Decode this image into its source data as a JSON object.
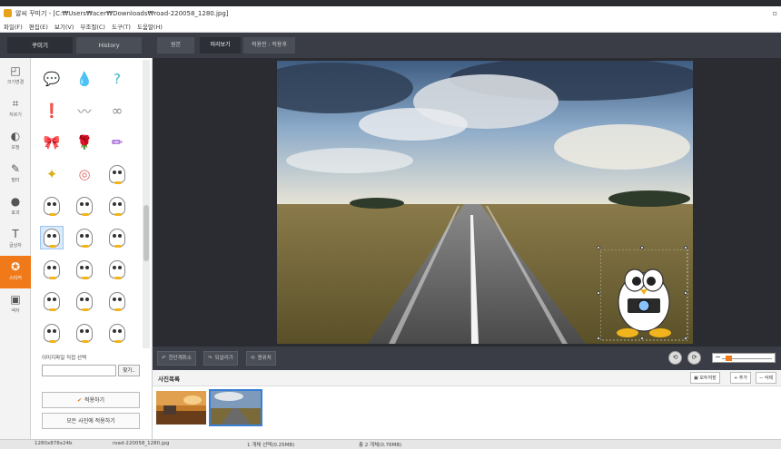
{
  "window": {
    "title": "알씨 꾸미기 - [C:₩Users₩acer₩Downloads₩road-220058_1280.jpg]",
    "control_label": "▫"
  },
  "menu": [
    "파일(F)",
    "편집(E)",
    "보기(V)",
    "부조절(C)",
    "도구(T)",
    "도움말(H)"
  ],
  "left_tabs": [
    {
      "label": "꾸미기",
      "active": true
    },
    {
      "label": "History",
      "active": false
    }
  ],
  "view_tabs": [
    {
      "label": "원본",
      "active": false
    },
    {
      "label": "미리보기",
      "active": true
    },
    {
      "label": "적용전 : 적용후",
      "active": false
    }
  ],
  "tools": [
    {
      "icon": "resize-icon",
      "glyph": "◰",
      "label": "크기변경"
    },
    {
      "icon": "crop-icon",
      "glyph": "⌗",
      "label": "자르기"
    },
    {
      "icon": "correction-icon",
      "glyph": "◐",
      "label": "보정"
    },
    {
      "icon": "brush-icon",
      "glyph": "✎",
      "label": "필터"
    },
    {
      "icon": "effect-icon",
      "glyph": "●",
      "label": "효과"
    },
    {
      "icon": "text-icon",
      "glyph": "T",
      "label": "글상자"
    },
    {
      "icon": "sticker-icon",
      "glyph": "✪",
      "label": "스티커",
      "active": true
    },
    {
      "icon": "frame-icon",
      "glyph": "▣",
      "label": "액자"
    }
  ],
  "stickers": [
    {
      "glyph": "💬",
      "color": "#f2c21a"
    },
    {
      "glyph": "💧",
      "color": "#3aa3e0"
    },
    {
      "glyph": "?",
      "color": "#38b5c8"
    },
    {
      "glyph": "❗",
      "color": "#3fb53a"
    },
    {
      "glyph": "〰",
      "color": "#888888"
    },
    {
      "glyph": "∞",
      "color": "#888888"
    },
    {
      "glyph": "🎀",
      "color": "#3a8fd0"
    },
    {
      "glyph": "🌹",
      "color": "#d03a3a"
    },
    {
      "glyph": "✏",
      "color": "#8a3ad0"
    },
    {
      "glyph": "✦",
      "color": "#d6b21a"
    },
    {
      "glyph": "◎",
      "color": "#e06a6a"
    },
    {
      "glyph": "penguin"
    },
    {
      "glyph": "penguin"
    },
    {
      "glyph": "penguin"
    },
    {
      "glyph": "penguin"
    },
    {
      "glyph": "penguin",
      "selected": true
    },
    {
      "glyph": "penguin"
    },
    {
      "glyph": "penguin"
    },
    {
      "glyph": "penguin"
    },
    {
      "glyph": "penguin"
    },
    {
      "glyph": "penguin"
    },
    {
      "glyph": "penguin"
    },
    {
      "glyph": "penguin"
    },
    {
      "glyph": "penguin"
    },
    {
      "glyph": "penguin"
    },
    {
      "glyph": "penguin"
    },
    {
      "glyph": "penguin"
    }
  ],
  "file_select": {
    "label": "이미지파일 직접 선택",
    "value": "",
    "button": "찾기.."
  },
  "apply": {
    "apply_label": "적용하기",
    "apply_all_label": "모든 사진에 적용하기"
  },
  "edit_bar": {
    "undo_label": "한단계취소",
    "redo_label": "되살리기",
    "reset_label": "원위치",
    "rotate_left_label": "⟲",
    "rotate_right_label": "⟳",
    "zoom_minus_label": "−"
  },
  "photo_list": {
    "label": "사진목록",
    "save_all": "모두저장",
    "add": "+ 추가",
    "delete": "− 삭제"
  },
  "status": {
    "dimensions": "1280x878x24b",
    "filename": "road-220058_1280.jpg",
    "selection": "1 개체 선택(0.25MB)",
    "total": "총 2 개체(0.76MB)"
  },
  "colors": {
    "accent": "#f07a1a",
    "dark": "#3a3d45",
    "selection": "#3b7fd4"
  }
}
